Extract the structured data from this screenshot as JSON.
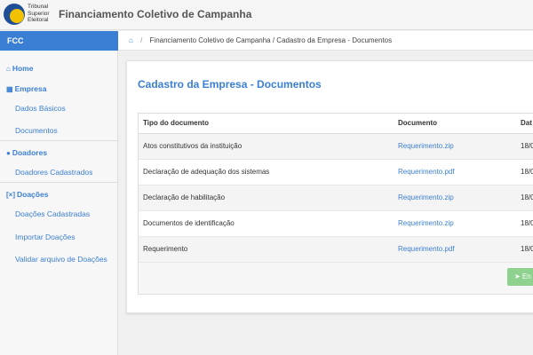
{
  "header": {
    "org_line1": "Tribunal",
    "org_line2": "Superior",
    "org_line3": "Eleitoral",
    "title": "Financiamento Coletivo de Campanha"
  },
  "nav": {
    "brand": "FCC",
    "breadcrumb": "Financiamento Coletivo de Campanha / Cadastro da Empresa - Documentos"
  },
  "sidebar": {
    "home": "Home",
    "empresa": "Empresa",
    "dados_basicos": "Dados Básicos",
    "documentos": "Documentos",
    "doadores": "Doadores",
    "doadores_cadastrados": "Doadores Cadastrados",
    "doacoes": "Doações",
    "doacoes_cadastradas": "Doações Cadastradas",
    "importar_doacoes": "Importar Doações",
    "validar_arquivo": "Validar arquivo de Doações"
  },
  "main": {
    "title": "Cadastro da Empresa - Documentos",
    "columns": [
      "Tipo do documento",
      "Documento",
      "Dat"
    ],
    "rows": [
      {
        "tipo": "Atos constitutivos da instituição",
        "documento": "Requerimento.zip",
        "data": "18/0"
      },
      {
        "tipo": "Declaração de adequação dos sistemas",
        "documento": "Requerimento.pdf",
        "data": "18/0"
      },
      {
        "tipo": "Declaração de habilitação",
        "documento": "Requerimento.zip",
        "data": "18/0"
      },
      {
        "tipo": "Documentos de identificação",
        "documento": "Requerimento.zip",
        "data": "18/0"
      },
      {
        "tipo": "Requerimento",
        "documento": "Requerimento.pdf",
        "data": "18/0"
      }
    ],
    "send_button": "En"
  },
  "colors": {
    "accent": "#3b7fd4",
    "button_green": "#8fd18f"
  }
}
